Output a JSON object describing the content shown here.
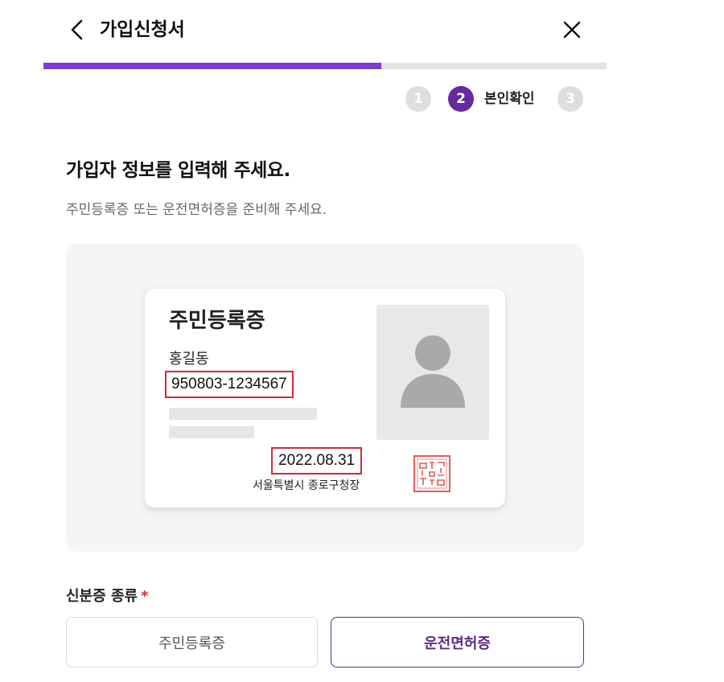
{
  "header": {
    "title": "가입신청서",
    "back_icon": "chevron-left-icon",
    "close_icon": "close-icon"
  },
  "progress": {
    "fraction": 0.6
  },
  "steps": [
    {
      "number": "1",
      "active": false
    },
    {
      "number": "2",
      "active": true,
      "label": "본인확인"
    },
    {
      "number": "3",
      "active": false
    }
  ],
  "main": {
    "heading": "가입자 정보를 입력해 주세요.",
    "subheading": "주민등록증 또는 운전면허증을 준비해 주세요."
  },
  "id_card": {
    "title": "주민등록증",
    "name": "홍길동",
    "rrn": "950803-1234567",
    "issue_date": "2022.08.31",
    "issuer": "서울특별시 종로구청장",
    "photo_icon": "person-silhouette-icon",
    "seal_icon": "official-seal-icon"
  },
  "id_type": {
    "label": "신분증 종류",
    "required": "*",
    "options": [
      {
        "label": "주민등록증",
        "selected": false
      },
      {
        "label": "운전면허증",
        "selected": true
      }
    ]
  },
  "colors": {
    "accent": "#7b3fd0",
    "step_active": "#652a9e",
    "highlight": "#d12a3a"
  }
}
